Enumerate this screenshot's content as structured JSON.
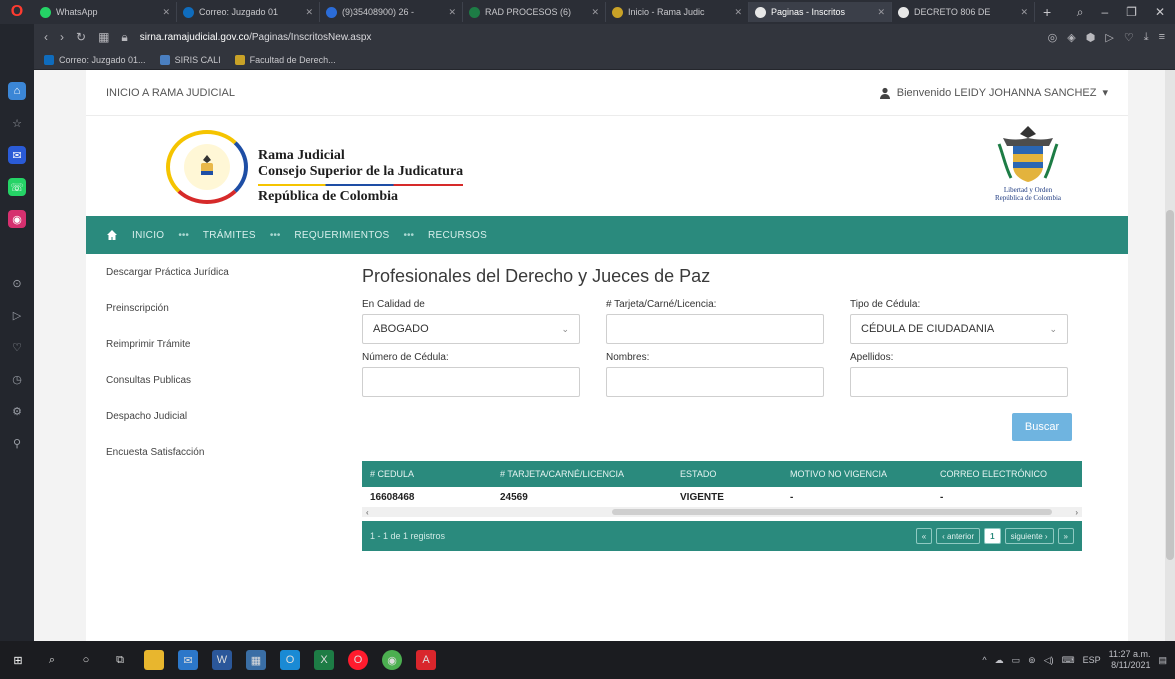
{
  "browser": {
    "tabs": [
      {
        "label": "WhatsApp",
        "color": "#25d366",
        "active": false
      },
      {
        "label": "Correo: Juzgado 01",
        "color": "#0f6cbd",
        "active": false
      },
      {
        "label": "(9)35408900) 26 -",
        "color": "#2b6cd8",
        "active": false
      },
      {
        "label": "RAD PROCESOS (6)",
        "color": "#1d7c45",
        "active": false
      },
      {
        "label": "Inicio - Rama Judic",
        "color": "#c9a227",
        "active": false
      },
      {
        "label": "Paginas - Inscritos",
        "color": "#e7e7e7",
        "active": true
      },
      {
        "label": "DECRETO 806 DE",
        "color": "#e7e7e7",
        "active": false
      }
    ],
    "new_tab": "+",
    "url_host": "sirna.ramajudicial.gov.co",
    "url_path": "/Paginas/InscritosNew.aspx",
    "bookmarks": [
      {
        "label": "Correo: Juzgado 01...",
        "color": "#0f6cbd"
      },
      {
        "label": "SIRIS CALI",
        "color": "#4a7fc1"
      },
      {
        "label": "Facultad de Derech...",
        "color": "#c9a227"
      }
    ]
  },
  "site": {
    "top_link": "INICIO A RAMA JUDICIAL",
    "welcome": "Bienvenido LEIDY JOHANNA SANCHEZ",
    "brand": {
      "line1": "Rama Judicial",
      "line2": "Consejo Superior de la Judicatura",
      "line3": "República de Colombia"
    },
    "coat_caption_1": "Libertad y Orden",
    "coat_caption_2": "República de Colombia",
    "nav": [
      "INICIO",
      "TRÁMITES",
      "REQUERIMIENTOS",
      "RECURSOS"
    ],
    "nav_sep": "•••",
    "left_menu": [
      "Descargar Práctica Jurídica",
      "Preinscripción",
      "Reimprimir Trámite",
      "Consultas Publicas",
      "Despacho Judicial",
      "Encuesta Satisfacción"
    ]
  },
  "form": {
    "title": "Profesionales del Derecho y Jueces de Paz",
    "calidad_label": "En Calidad de",
    "calidad_value": "ABOGADO",
    "tarjeta_label": "# Tarjeta/Carné/Licencia:",
    "tarjeta_value": "",
    "tipo_label": "Tipo de Cédula:",
    "tipo_value": "CÉDULA DE CIUDADANIA",
    "cedula_label": "Número de Cédula:",
    "cedula_value": "",
    "nombres_label": "Nombres:",
    "nombres_value": "",
    "apellidos_label": "Apellidos:",
    "apellidos_value": "",
    "search_button": "Buscar"
  },
  "results": {
    "columns": [
      "# CEDULA",
      "# TARJETA/CARNÉ/LICENCIA",
      "ESTADO",
      "MOTIVO NO VIGENCIA",
      "CORREO ELECTRÓNICO"
    ],
    "rows": [
      [
        "16608468",
        "24569",
        "VIGENTE",
        "-",
        "-"
      ]
    ],
    "footer": "1 - 1 de 1 registros",
    "pager": {
      "first": "«",
      "prev": "‹ anterior",
      "current": "1",
      "next": "siguiente ›",
      "last": "»"
    }
  },
  "taskbar": {
    "time": "11:27 a.m.",
    "date": "8/11/2021",
    "lang": "ESP"
  },
  "colors": {
    "nav_teal": "#2a8a7d",
    "search_blue": "#6fb4e0"
  }
}
